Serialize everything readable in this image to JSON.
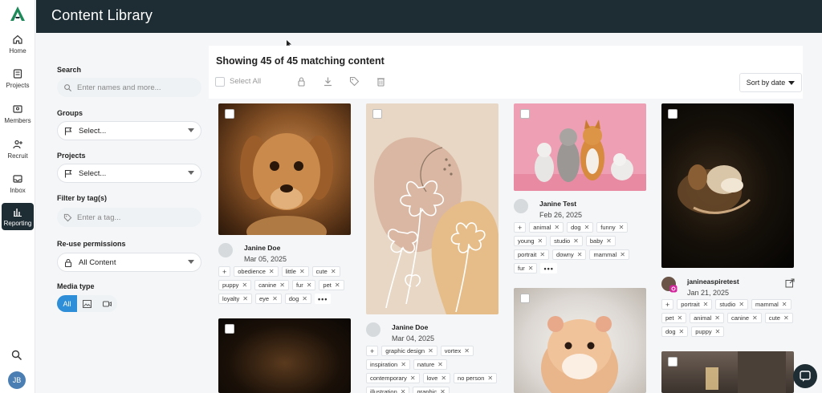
{
  "app": {
    "title": "Content Library"
  },
  "nav": [
    {
      "id": "home",
      "label": "Home"
    },
    {
      "id": "projects",
      "label": "Projects"
    },
    {
      "id": "members",
      "label": "Members"
    },
    {
      "id": "recruit",
      "label": "Recruit"
    },
    {
      "id": "inbox",
      "label": "Inbox"
    },
    {
      "id": "reporting",
      "label": "Reporting",
      "active": true
    }
  ],
  "user": {
    "initials": "JB"
  },
  "filters": {
    "search_label": "Search",
    "search_placeholder": "Enter names and more...",
    "groups_label": "Groups",
    "groups_value": "Select...",
    "projects_label": "Projects",
    "projects_value": "Select...",
    "tags_label": "Filter by tag(s)",
    "tags_placeholder": "Enter a tag...",
    "reuse_label": "Re-use permissions",
    "reuse_value": "All Content",
    "media_label": "Media type",
    "media_all": "All"
  },
  "results": {
    "showing": "Showing 45 of 45 matching content",
    "select_all": "Select All",
    "sort": "Sort by date"
  },
  "cards": [
    {
      "id": "c1",
      "author": "Janine Doe",
      "date": "Mar 05, 2025",
      "tags": [
        "obedience",
        "little",
        "cute",
        "puppy",
        "canine",
        "fur",
        "pet",
        "loyalty",
        "eye",
        "dog"
      ]
    },
    {
      "id": "c2",
      "author": "Janine Doe",
      "date": "Mar 04, 2025",
      "tags": [
        "graphic design",
        "vortex",
        "inspiration",
        "nature",
        "contemporary",
        "love",
        "no person",
        "illustration",
        "graphic"
      ]
    },
    {
      "id": "c3",
      "author": "Janine Test",
      "date": "Feb 26, 2025",
      "tags": [
        "animal",
        "dog",
        "funny",
        "young",
        "studio",
        "baby",
        "portrait",
        "downy",
        "mammal",
        "fur"
      ]
    },
    {
      "id": "c4",
      "author": "janineaspiretest",
      "date": "Jan 21, 2025",
      "tags": [
        "portrait",
        "studio",
        "mammal",
        "pet",
        "animal",
        "canine",
        "cute",
        "dog",
        "puppy"
      ]
    }
  ],
  "colors": {
    "header": "#1e2d34",
    "accent": "#2f8ed8",
    "brand": "#1e8a5a"
  },
  "icons": {
    "logo": "aspire-logo-icon",
    "external": "external-link-icon",
    "chat": "chat-bubble-icon"
  }
}
